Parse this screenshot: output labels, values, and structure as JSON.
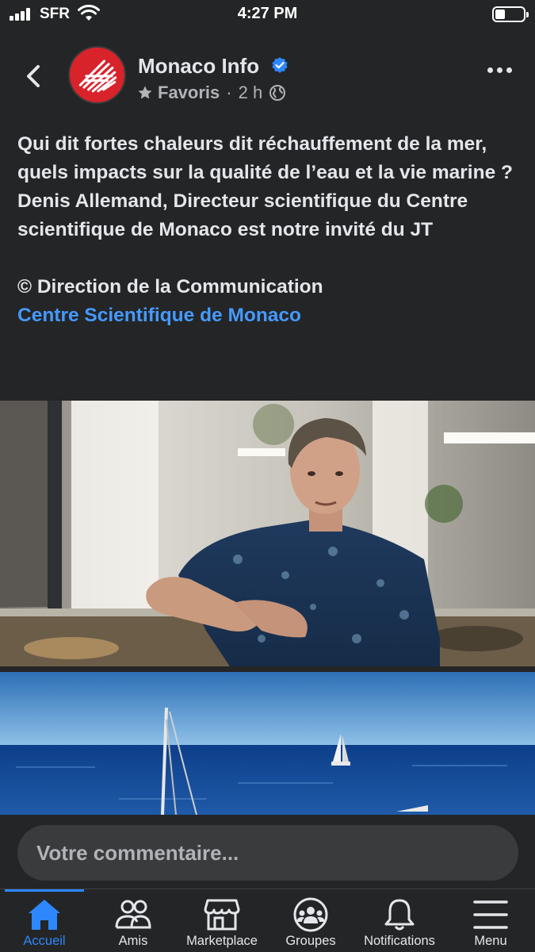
{
  "status_bar": {
    "carrier": "SFR",
    "time": "4:27 PM",
    "battery_level": 0.35
  },
  "post": {
    "page_name": "Monaco Info",
    "verified": true,
    "audience_label": "Favoris",
    "time_ago": "2 h",
    "text_lines": [
      "Qui dit fortes chaleurs dit réchauffement de la mer, quels impacts sur la qualité de l’eau et la vie marine ?",
      "Denis Allemand, Directeur scientifique du Centre scientifique de Monaco est notre invité du JT"
    ],
    "credit": "© Direction de la Communication",
    "link_text": "Centre Scientifique de Monaco",
    "icons": {
      "back": "chevron-left-icon",
      "more": "more-horizontal-icon",
      "verified": "verified-badge-icon",
      "favorites": "star-icon",
      "privacy": "globe-icon"
    }
  },
  "comment": {
    "placeholder": "Votre commentaire..."
  },
  "tabs": [
    {
      "label": "Accueil",
      "icon": "home-icon",
      "active": true
    },
    {
      "label": "Amis",
      "icon": "friends-icon",
      "active": false
    },
    {
      "label": "Marketplace",
      "icon": "marketplace-icon",
      "active": false
    },
    {
      "label": "Groupes",
      "icon": "groups-icon",
      "active": false
    },
    {
      "label": "Notifications",
      "icon": "bell-icon",
      "active": false
    },
    {
      "label": "Menu",
      "icon": "menu-icon",
      "active": false
    }
  ],
  "colors": {
    "background": "#242526",
    "text": "#e4e6eb",
    "secondary_text": "#b0b3b8",
    "link": "#4599ff",
    "accent": "#2d88ff",
    "brand_red": "#d8232a"
  }
}
